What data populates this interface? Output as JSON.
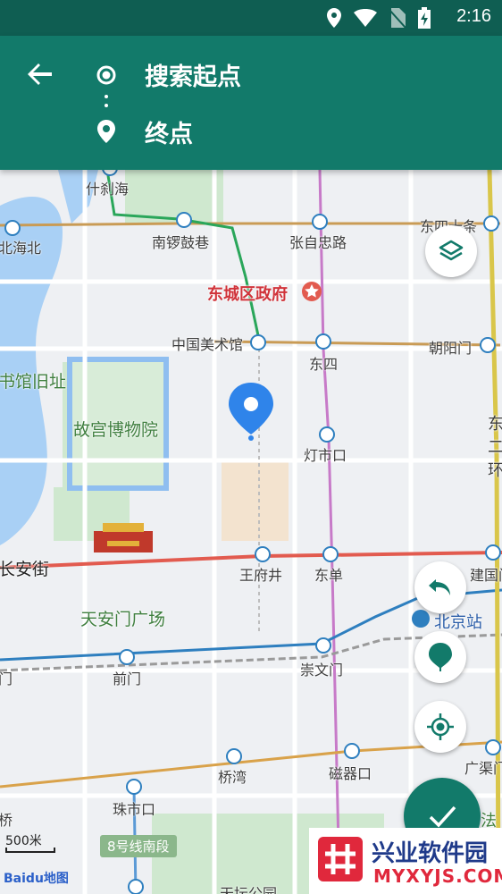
{
  "status_bar": {
    "time": "2:16",
    "icons": [
      "location-icon",
      "wifi-icon",
      "no-sim-icon",
      "battery-charging-icon"
    ]
  },
  "app_bar": {
    "back_icon": "back-arrow-icon",
    "start_placeholder": "搜索起点",
    "end_placeholder": "终点"
  },
  "map": {
    "labels": {
      "shichahai": "什刹海",
      "beihaibei": "北海北",
      "nanluoguxiang": "南锣鼓巷",
      "zhangzizhonglu": "张自忠路",
      "dongsishitiao": "东四十条",
      "dongchengqu": "东城区政府",
      "meishuguan": "中国美术馆",
      "dongsi": "东四",
      "chaoyangmen": "朝阳门",
      "shuguanjiuzhi": "书馆旧址",
      "gugong": "故宫博物院",
      "dengshikou": "灯市口",
      "donger": "东二环",
      "changanjie": "长安街",
      "wangfujing": "王府井",
      "dongdan": "东单",
      "jianguomen": "建国门",
      "tiananmen": "天安门广场",
      "beijingzhan": "北京站",
      "qianmen": "前门",
      "men": "门",
      "chongwenmen": "崇文门",
      "qiaowan": "桥湾",
      "ciqikou": "磁器口",
      "guangqumen": "广渠门",
      "zhushikou": "珠市口",
      "qiao": "桥",
      "fa": "法",
      "tiantan": "天坛公园"
    },
    "scale": "500米",
    "route_badge": "8号线南段",
    "provider": "Baidu地图"
  },
  "controls": {
    "layers_icon": "layers-icon",
    "undo_icon": "undo-icon",
    "pin_icon": "drop-pin-icon",
    "locate_icon": "my-location-icon",
    "confirm_icon": "check-icon"
  },
  "watermark": {
    "title": "兴业软件园",
    "subtitle": "MYXYJS.COM"
  },
  "colors": {
    "app_bar": "#127a6a",
    "status_bar": "#0f5e52",
    "marker": "#2f84ea",
    "line_red": "#e25b4f",
    "line_purple": "#c77ac8",
    "line_orange": "#d9a24a"
  }
}
